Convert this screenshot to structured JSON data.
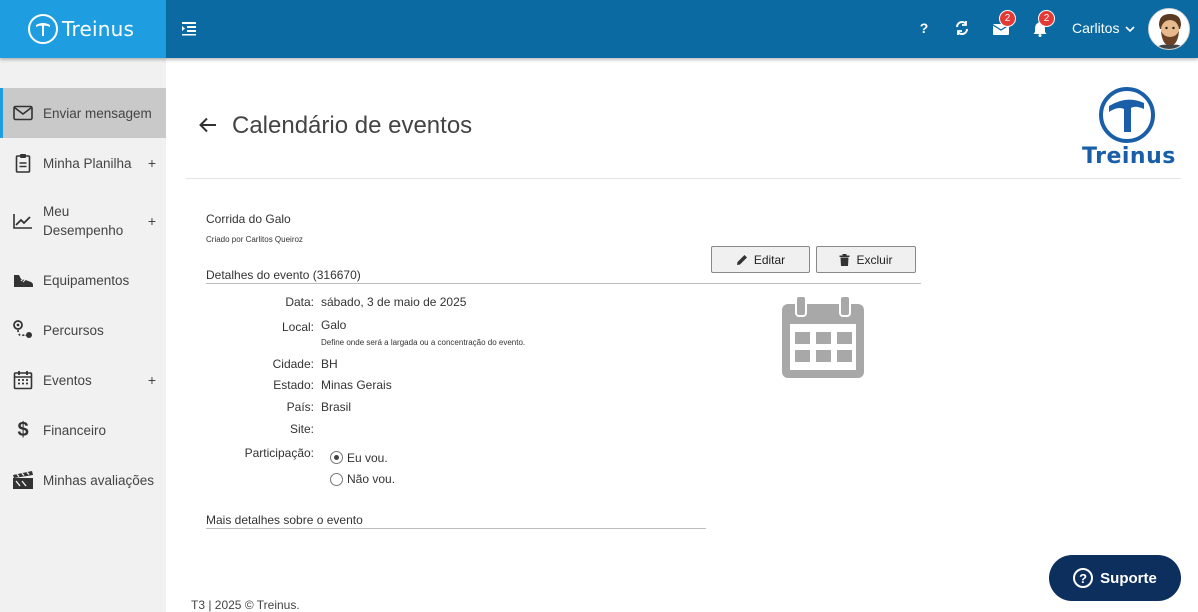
{
  "header": {
    "brand": "Treinus",
    "help_label": "?",
    "messages_count": "2",
    "notifications_count": "2",
    "user_name": "Carlitos"
  },
  "sidebar": {
    "items": [
      {
        "label": "Enviar mensagem",
        "icon": "envelope-icon",
        "active": true
      },
      {
        "label": "Minha Planilha",
        "icon": "clipboard-icon",
        "expandable": true
      },
      {
        "label": "Meu Desempenho",
        "icon": "chart-line-icon",
        "expandable": true
      },
      {
        "label": "Equipamentos",
        "icon": "shoe-icon"
      },
      {
        "label": "Percursos",
        "icon": "route-icon"
      },
      {
        "label": "Eventos",
        "icon": "calendar-icon",
        "expandable": true
      },
      {
        "label": "Financeiro",
        "icon": "dollar-icon"
      },
      {
        "label": "Minhas avaliações",
        "icon": "clapboard-icon"
      }
    ],
    "plus": "+"
  },
  "page": {
    "title": "Calendário de eventos",
    "logo_text": "Treinus"
  },
  "event": {
    "name": "Corrida do Galo",
    "author": "Criado por Carlitos Queiroz",
    "details_heading": "Detalhes do evento (316670)",
    "edit_label": "Editar",
    "delete_label": "Excluir",
    "fields": {
      "date_label": "Data:",
      "date_value": "sábado, 3 de maio de 2025",
      "local_label": "Local:",
      "local_value": "Galo",
      "local_note": "Define onde será a largada ou a concentração do evento.",
      "city_label": "Cidade:",
      "city_value": "BH",
      "state_label": "Estado:",
      "state_value": "Minas Gerais",
      "country_label": "País:",
      "country_value": "Brasil",
      "site_label": "Site:",
      "site_value": "",
      "participation_label": "Participação:"
    },
    "participation_options": [
      {
        "label": "Eu vou.",
        "checked": true
      },
      {
        "label": "Não vou.",
        "checked": false
      }
    ],
    "more_heading": "Mais detalhes sobre o evento"
  },
  "footer": {
    "text": "T3 | 2025 © Treinus."
  },
  "support": {
    "label": "Suporte"
  },
  "colors": {
    "topbar": "#0a6aa1",
    "brand": "#1e9ee0",
    "badge": "#e53935",
    "support": "#0c2f5e",
    "logo": "#1a5ea8"
  }
}
